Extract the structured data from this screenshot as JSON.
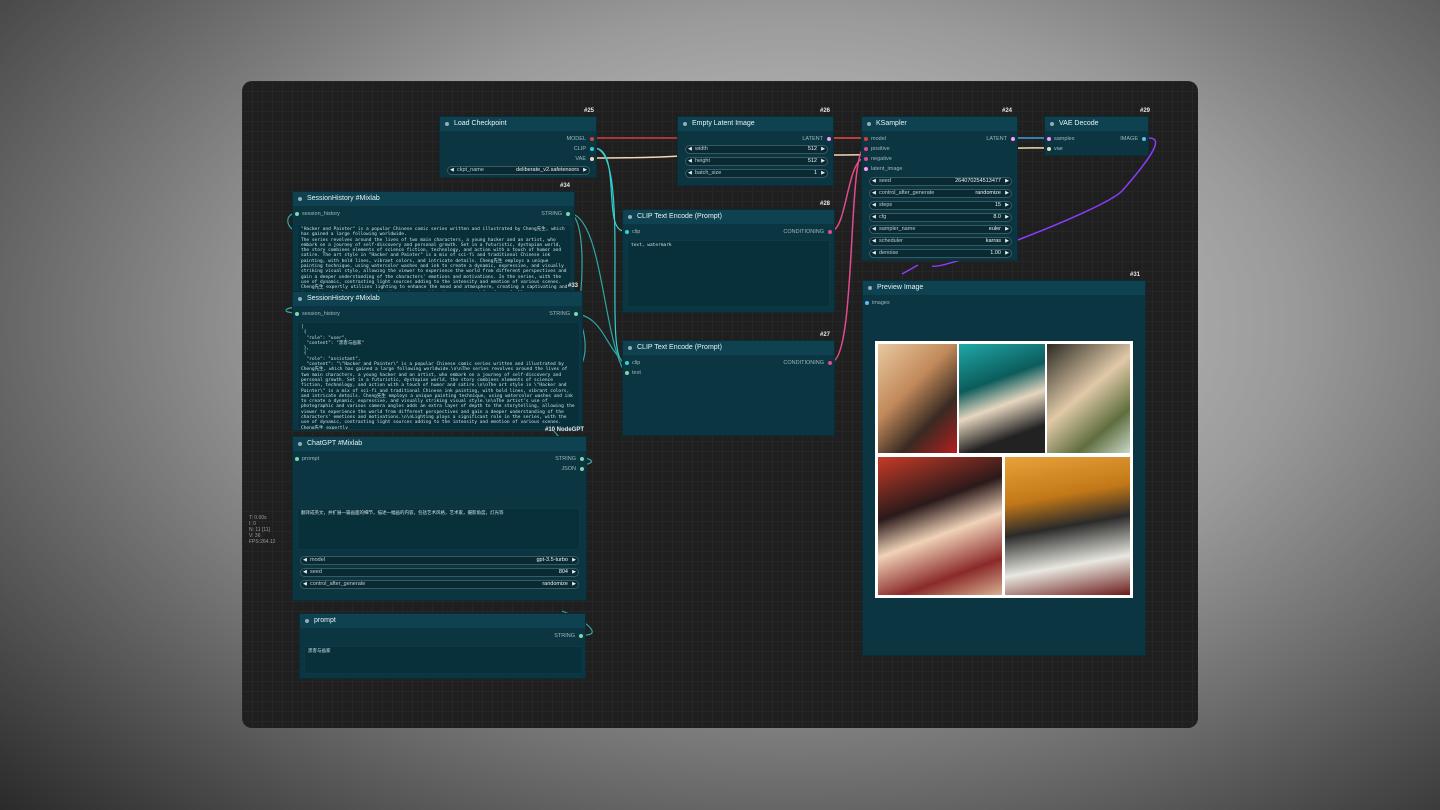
{
  "nodes": {
    "load_checkpoint": {
      "id": "#25",
      "title": "Load Checkpoint",
      "outputs": [
        "MODEL",
        "CLIP",
        "VAE"
      ],
      "ckpt_label": "ckpt_name",
      "ckpt_value": "deliberate_v2.safetensors"
    },
    "empty_latent": {
      "id": "#26",
      "title": "Empty Latent Image",
      "output": "LATENT",
      "width_label": "width",
      "width_value": "512",
      "height_label": "height",
      "height_value": "512",
      "batch_label": "batch_size",
      "batch_value": "1"
    },
    "ksampler": {
      "id": "#24",
      "title": "KSampler",
      "inputs": [
        "model",
        "positive",
        "negative",
        "latent_image"
      ],
      "output": "LATENT",
      "widgets": [
        {
          "label": "seed",
          "value": "264070254513477"
        },
        {
          "label": "control_after_generate",
          "value": "randomize"
        },
        {
          "label": "steps",
          "value": "15"
        },
        {
          "label": "cfg",
          "value": "8.0"
        },
        {
          "label": "sampler_name",
          "value": "euler"
        },
        {
          "label": "scheduler",
          "value": "karras"
        },
        {
          "label": "denoise",
          "value": "1.00"
        }
      ]
    },
    "vae_decode": {
      "id": "#29",
      "title": "VAE Decode",
      "inputs": [
        "samples",
        "vae"
      ],
      "output": "IMAGE"
    },
    "clip_neg": {
      "id": "#28",
      "title": "CLIP Text Encode (Prompt)",
      "input": "clip",
      "output": "CONDITIONING",
      "text": "text, watermark"
    },
    "clip_pos": {
      "id": "#27",
      "title": "CLIP Text Encode (Prompt)",
      "inputs": [
        "clip",
        "text"
      ],
      "output": "CONDITIONING"
    },
    "session_history_1": {
      "id": "#34",
      "title": "SessionHistory #Mixlab",
      "input": "session_history",
      "output": "STRING",
      "text": "\"Hacker and Painter\" is a popular Chinese comic series written and illustrated by Cheng先生, which has gained a large following worldwide.\nThe series revolves around the lives of two main characters, a young hacker and an artist, who embark on a journey of self-discovery and personal growth. Set in a futuristic, dystopian world, the story combines elements of science fiction, technology, and action with a touch of humor and satire. The art style in \"Hacker and Painter\" is a mix of sci-fi and traditional Chinese ink painting, with bold lines, vibrant colors, and intricate details. Cheng先生 employs a unique painting technique, using watercolor washes and ink to create a dynamic, expressive, and visually striking visual style, allowing the viewer to experience the world from different perspectives and gain a deeper understanding of the characters' emotions and motivations. In the series, with the use of dynamic, contrasting light sources adding to the intensity and emotion of various scenes. Cheng先生 expertly utilizes lighting to enhance the mood and atmosphere, creating a captivating and immersive visual experience for the readers, making it a must-read for fans of all ages."
    },
    "session_history_2": {
      "id": "#33",
      "title": "SessionHistory #Mixlab",
      "input": "session_history",
      "output": "STRING",
      "text": "[\n {\n  \"role\": \"user\",\n  \"content\": \"黑客与画家\"\n },\n {\n  \"role\": \"assistant\",\n  \"content\": \"\\\"Hacker and Painter\\\" is a popular Chinese comic series written and illustrated by Cheng先生, which has gained a large following worldwide.\\n\\nThe series revolves around the lives of two main characters, a young hacker and an artist, who embark on a journey of self-discovery and personal growth. Set in a futuristic, dystopian world, the story combines elements of science fiction, technology, and action with a touch of humor and satire.\\n\\nThe art style in \\\"Hacker and Painter\\\" is a mix of sci-fi and traditional Chinese ink painting, with bold lines, vibrant colors, and intricate details. Cheng先生 employs a unique painting technique, using watercolor washes and ink to create a dynamic, expressive, and visually striking visual style.\\n\\nThe artist's use of photographic and various camera angles adds an extra layer of depth to the storytelling, allowing the viewer to experience the world from different perspectives and gain a deeper understanding of the characters' emotions and motivations.\\n\\nLighting plays a significant role in the series, with the use of dynamic, contrasting light sources adding to the intensity and emotion of various scenes. Cheng先生 expertly"
    },
    "chatgpt": {
      "id": "#10 NodeGPT",
      "title": "ChatGPT #Mixlab",
      "input": "prompt",
      "outputs": [
        "STRING",
        "JSON"
      ],
      "text": "翻译成英文，并扩展一篇画面的细节，描述一幅画的内容，包括艺术风格，艺术家，摄影角度，灯光等",
      "widgets": [
        {
          "label": "model",
          "value": "gpt-3.5-turbo"
        },
        {
          "label": "seed",
          "value": "804"
        },
        {
          "label": "control_after_generate",
          "value": "randomize"
        }
      ]
    },
    "prompt": {
      "title": "prompt",
      "output": "STRING",
      "text": "黑客与画家"
    },
    "preview": {
      "id": "#31",
      "title": "Preview Image",
      "input": "images"
    }
  },
  "stats": [
    "T: 0.00s",
    "I: 0",
    "N: 11 [11]",
    "V: 36",
    "FPS:264.12"
  ],
  "colors": {
    "model": "#b39ddb",
    "clip": "#ffd500",
    "vae": "#ff6e6e",
    "latent": "#ff9cf9",
    "conditioning": "#ffa931",
    "image": "#64b5f6",
    "string": "#7ed7a5"
  }
}
